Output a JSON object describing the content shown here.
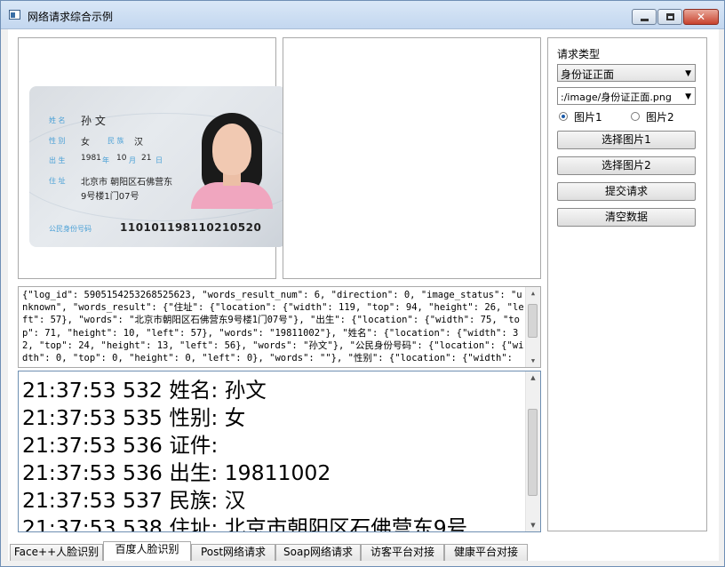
{
  "window": {
    "title": "网络请求综合示例"
  },
  "image_panel_left": {
    "card": {
      "name_label": "姓 名",
      "name": "孙 文",
      "sex_label": "性 别",
      "sex": "女",
      "ethnic_label": "民 族",
      "ethnic": "汉",
      "birth_label": "出 生",
      "birth_year": "1981",
      "birth_year_unit": "年",
      "birth_month": "10",
      "birth_month_unit": "月",
      "birth_day": "21",
      "birth_day_unit": "日",
      "address_label": "住 址",
      "address_line1": "北京市 朝阳区石佛营东",
      "address_line2": "9号楼1门07号",
      "id_label": "公民身份号码",
      "id_number": "110101198110210520"
    }
  },
  "json_output": "{\"log_id\": 5905154253268525623, \"words_result_num\": 6, \"direction\": 0, \"image_status\": \"unknown\", \"words_result\": {\"住址\": {\"location\": {\"width\": 119, \"top\": 94, \"height\": 26, \"left\": 57}, \"words\": \"北京市朝阳区石佛营东9号楼1门07号\"}, \"出生\": {\"location\": {\"width\": 75, \"top\": 71, \"height\": 10, \"left\": 57}, \"words\": \"19811002\"}, \"姓名\": {\"location\": {\"width\": 32, \"top\": 24, \"height\": 13, \"left\": 56}, \"words\": \"孙文\"}, \"公民身份号码\": {\"location\": {\"width\": 0, \"top\": 0, \"height\": 0, \"left\": 0}, \"words\": \"\"}, \"性别\": {\"location\": {\"width\":",
  "log": {
    "lines": [
      "21:37:53 532  姓名: 孙文",
      "21:37:53 535  性别: 女",
      "21:37:53 536  证件:",
      "21:37:53 536  出生: 19811002",
      "21:37:53 537  民族: 汉",
      "21:37:53 538  住址: 北京市朝阳区石佛营东9号"
    ]
  },
  "controls": {
    "request_type_label": "请求类型",
    "request_type_value": "身份证正面",
    "image_path_value": ":/image/身份证正面.png",
    "radio1_label": "图片1",
    "radio2_label": "图片2",
    "radio_selected": "图片1",
    "btn_select_image1": "选择图片1",
    "btn_select_image2": "选择图片2",
    "btn_submit": "提交请求",
    "btn_clear": "清空数据"
  },
  "tabs": [
    {
      "label": "Face++人脸识别",
      "active": false
    },
    {
      "label": "百度人脸识别",
      "active": true
    },
    {
      "label": "Post网络请求",
      "active": false
    },
    {
      "label": "Soap网络请求",
      "active": false
    },
    {
      "label": "访客平台对接",
      "active": false
    },
    {
      "label": "健康平台对接",
      "active": false
    }
  ]
}
